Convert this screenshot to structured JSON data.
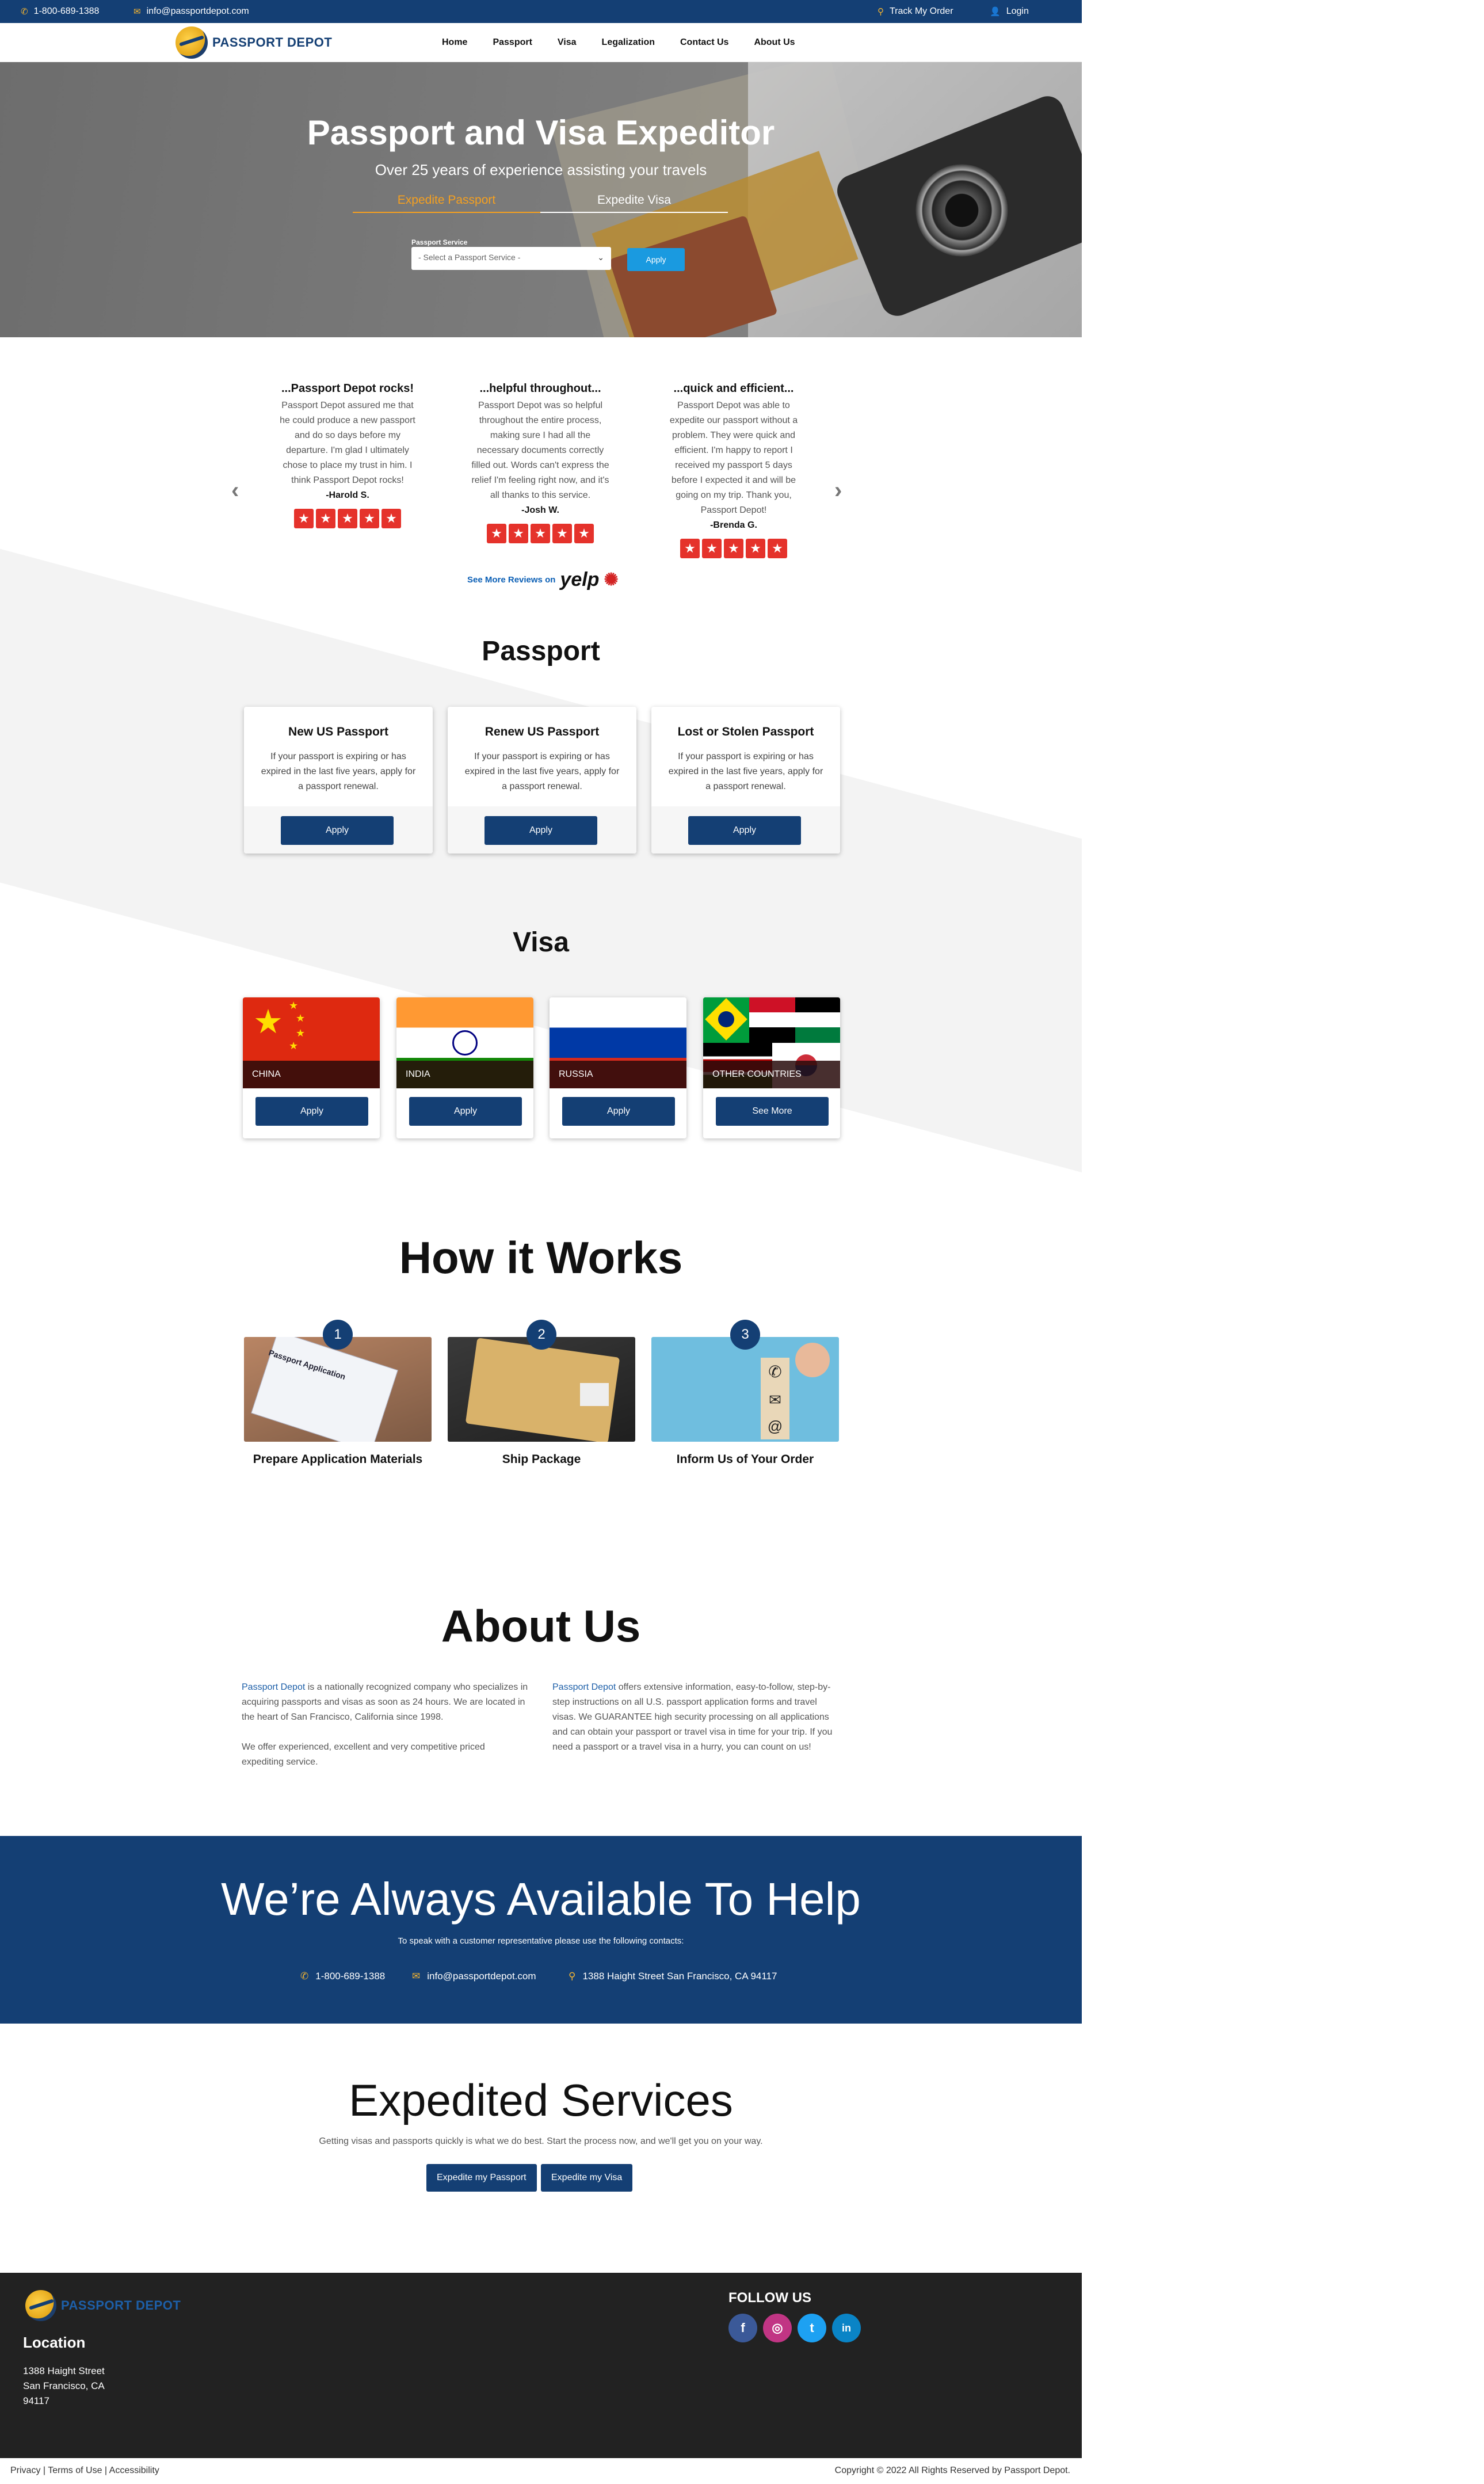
{
  "topbar": {
    "phone": "1-800-689-1388",
    "email": "info@passportdepot.com",
    "track": "Track My Order",
    "login": "Login"
  },
  "brand": {
    "name": "PASSPORT DEPOT",
    "primary_color": "#143f74",
    "accent_color": "#f5a020"
  },
  "nav": {
    "items": [
      "Home",
      "Passport",
      "Visa",
      "Legalization",
      "Contact Us",
      "About Us"
    ]
  },
  "hero": {
    "title": "Passport and Visa Expeditor",
    "subtitle": "Over 25 years of experience assisting your travels",
    "tab_passport": "Expedite Passport",
    "tab_visa": "Expedite Visa",
    "field_label": "Passport Service",
    "select_value": "- Select a Passport Service -",
    "apply_label": "Apply"
  },
  "reviews": [
    {
      "title": "...Passport Depot rocks!",
      "text": "Passport Depot assured me that he could produce a new passport and do so days before my departure. I'm glad I ultimately chose to place my trust in him. I think Passport Depot rocks!",
      "author": "-Harold S."
    },
    {
      "title": "...helpful throughout...",
      "text": "Passport Depot was so helpful throughout the entire process, making sure I had all the necessary documents correctly filled out. Words can't express the relief I'm feeling right now, and it's all thanks to this service.",
      "author": "-Josh W."
    },
    {
      "title": "...quick and efficient...",
      "text": "Passport Depot was able to expedite our passport without a problem. They were quick and efficient. I'm happy to report I received my passport 5 days before I expected it and will be going on my trip. Thank you, Passport Depot!",
      "author": "-Brenda G."
    }
  ],
  "rating_stars": 5,
  "yelp": {
    "text": "See More Reviews on",
    "logo": "yelp"
  },
  "passport_section": {
    "title": "Passport",
    "cards": [
      {
        "title": "New US Passport",
        "text": "If your passport is expiring or has expired in the last five years, apply for a passport renewal.",
        "button": "Apply"
      },
      {
        "title": "Renew US Passport",
        "text": "If your passport is expiring or has expired in the last five years, apply for a passport renewal.",
        "button": "Apply"
      },
      {
        "title": "Lost or Stolen Passport",
        "text": "If your passport is expiring or has expired in the last five years, apply for a passport renewal.",
        "button": "Apply"
      }
    ]
  },
  "visa_section": {
    "title": "Visa",
    "cards": [
      {
        "country": "CHINA",
        "button": "Apply"
      },
      {
        "country": "INDIA",
        "button": "Apply"
      },
      {
        "country": "RUSSIA",
        "button": "Apply"
      },
      {
        "country": "OTHER COUNTRIES",
        "button": "See More"
      }
    ]
  },
  "how_section": {
    "title": "How it Works",
    "steps": [
      {
        "num": "1",
        "caption": "Prepare Application Materials",
        "image_text": "Passport Application"
      },
      {
        "num": "2",
        "caption": "Ship Package"
      },
      {
        "num": "3",
        "caption": "Inform Us of Your Order"
      }
    ]
  },
  "about_section": {
    "title": "About Us",
    "col1_brand": "Passport Depot",
    "col1_p1": " is a nationally recognized company who specializes in acquiring passports and visas as soon as 24 hours. We are located in the heart of San Francisco, California since 1998.",
    "col1_p2": "We offer experienced, excellent and very competitive priced expediting service.",
    "col2_brand": "Passport Depot",
    "col2_p1": " offers extensive information, easy-to-follow, step-by-step instructions on all U.S. passport application forms and travel visas. We GUARANTEE high security processing on all applications and can obtain your passport or travel visa in time for your trip. If you need a passport or a travel visa in a hurry, you can count on us!"
  },
  "help_section": {
    "title": "We’re Always Available To Help",
    "subtitle": "To speak with a customer representative please use the following contacts:",
    "phone": "1-800-689-1388",
    "email": "info@passportdepot.com",
    "address": "1388 Haight Street San Francisco, CA 94117"
  },
  "expedited_section": {
    "title": "Expedited Services",
    "subtitle": "Getting visas and passports quickly is what we do best. Start the process now, and we'll get you on your way.",
    "btn_passport": "Expedite my Passport",
    "btn_visa": "Expedite my Visa"
  },
  "footer": {
    "location_title": "Location",
    "address_line1": "1388 Haight Street",
    "address_line2": "San Francisco, CA",
    "address_line3": "94117",
    "follow_title": "FOLLOW US",
    "social": [
      {
        "name": "facebook-icon",
        "glyph": "f",
        "color": "#3b5998"
      },
      {
        "name": "instagram-icon",
        "glyph": "◎",
        "color": "#c13584"
      },
      {
        "name": "twitter-icon",
        "glyph": "t",
        "color": "#1da1f2"
      },
      {
        "name": "linkedin-icon",
        "glyph": "in",
        "color": "#0a84c6"
      }
    ]
  },
  "legal": {
    "privacy": "Privacy",
    "terms": "Terms of Use",
    "accessibility": "Accessibility",
    "copyright": "Copyright © 2022 All Rights Reserved by Passport Depot."
  }
}
